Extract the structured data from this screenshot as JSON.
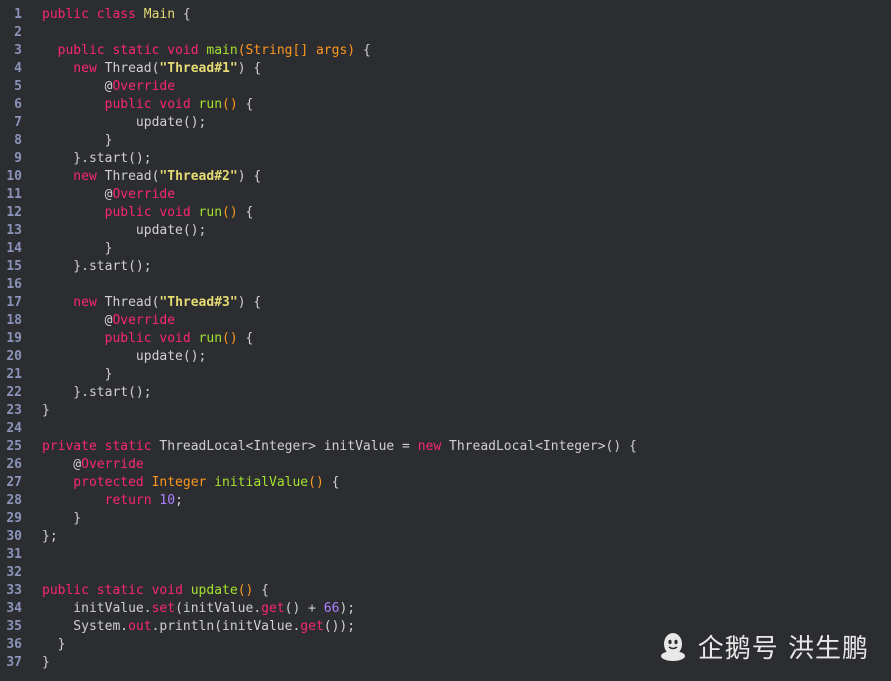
{
  "code_lines": [
    {
      "n": "1",
      "tokens": [
        {
          "t": "public ",
          "c": "kw"
        },
        {
          "t": "class ",
          "c": "kw"
        },
        {
          "t": "Main",
          "c": "ty"
        },
        {
          "t": " {",
          "c": "pl"
        }
      ]
    },
    {
      "n": "2",
      "tokens": []
    },
    {
      "n": "3",
      "tokens": [
        {
          "t": "  public ",
          "c": "kw"
        },
        {
          "t": "static ",
          "c": "kw"
        },
        {
          "t": "void ",
          "c": "kw"
        },
        {
          "t": "main",
          "c": "fn"
        },
        {
          "t": "(",
          "c": "pm"
        },
        {
          "t": "String[] ",
          "c": "pm"
        },
        {
          "t": "args",
          "c": "pm"
        },
        {
          "t": ")",
          "c": "pm"
        },
        {
          "t": " {",
          "c": "pl"
        }
      ]
    },
    {
      "n": "4",
      "tokens": [
        {
          "t": "    new ",
          "c": "kw"
        },
        {
          "t": "Thread(",
          "c": "pl"
        },
        {
          "t": "\"Thread#1\"",
          "c": "st"
        },
        {
          "t": ") {",
          "c": "pl"
        }
      ]
    },
    {
      "n": "5",
      "tokens": [
        {
          "t": "        @",
          "c": "pl"
        },
        {
          "t": "Override",
          "c": "an"
        }
      ]
    },
    {
      "n": "6",
      "tokens": [
        {
          "t": "        public ",
          "c": "kw"
        },
        {
          "t": "void ",
          "c": "kw"
        },
        {
          "t": "run",
          "c": "fn"
        },
        {
          "t": "()",
          "c": "pm"
        },
        {
          "t": " {",
          "c": "pl"
        }
      ]
    },
    {
      "n": "7",
      "tokens": [
        {
          "t": "            update();",
          "c": "pl"
        }
      ]
    },
    {
      "n": "8",
      "tokens": [
        {
          "t": "        }",
          "c": "pl"
        }
      ]
    },
    {
      "n": "9",
      "tokens": [
        {
          "t": "    }.start();",
          "c": "pl"
        }
      ]
    },
    {
      "n": "10",
      "tokens": [
        {
          "t": "    new ",
          "c": "kw"
        },
        {
          "t": "Thread(",
          "c": "pl"
        },
        {
          "t": "\"Thread#2\"",
          "c": "st"
        },
        {
          "t": ") {",
          "c": "pl"
        }
      ]
    },
    {
      "n": "11",
      "tokens": [
        {
          "t": "        @",
          "c": "pl"
        },
        {
          "t": "Override",
          "c": "an"
        }
      ]
    },
    {
      "n": "12",
      "tokens": [
        {
          "t": "        public ",
          "c": "kw"
        },
        {
          "t": "void ",
          "c": "kw"
        },
        {
          "t": "run",
          "c": "fn"
        },
        {
          "t": "()",
          "c": "pm"
        },
        {
          "t": " {",
          "c": "pl"
        }
      ]
    },
    {
      "n": "13",
      "tokens": [
        {
          "t": "            update();",
          "c": "pl"
        }
      ]
    },
    {
      "n": "14",
      "tokens": [
        {
          "t": "        }",
          "c": "pl"
        }
      ]
    },
    {
      "n": "15",
      "tokens": [
        {
          "t": "    }.start();",
          "c": "pl"
        }
      ]
    },
    {
      "n": "16",
      "tokens": []
    },
    {
      "n": "17",
      "tokens": [
        {
          "t": "    new ",
          "c": "kw"
        },
        {
          "t": "Thread(",
          "c": "pl"
        },
        {
          "t": "\"Thread#3\"",
          "c": "st"
        },
        {
          "t": ") {",
          "c": "pl"
        }
      ]
    },
    {
      "n": "18",
      "tokens": [
        {
          "t": "        @",
          "c": "pl"
        },
        {
          "t": "Override",
          "c": "an"
        }
      ]
    },
    {
      "n": "19",
      "tokens": [
        {
          "t": "        public ",
          "c": "kw"
        },
        {
          "t": "void ",
          "c": "kw"
        },
        {
          "t": "run",
          "c": "fn"
        },
        {
          "t": "()",
          "c": "pm"
        },
        {
          "t": " {",
          "c": "pl"
        }
      ]
    },
    {
      "n": "20",
      "tokens": [
        {
          "t": "            update();",
          "c": "pl"
        }
      ]
    },
    {
      "n": "21",
      "tokens": [
        {
          "t": "        }",
          "c": "pl"
        }
      ]
    },
    {
      "n": "22",
      "tokens": [
        {
          "t": "    }.start();",
          "c": "pl"
        }
      ]
    },
    {
      "n": "23",
      "tokens": [
        {
          "t": "}",
          "c": "pl"
        }
      ]
    },
    {
      "n": "24",
      "tokens": []
    },
    {
      "n": "25",
      "tokens": [
        {
          "t": "private ",
          "c": "kw"
        },
        {
          "t": "static ",
          "c": "kw"
        },
        {
          "t": "ThreadLocal<Integer> initValue = ",
          "c": "pl"
        },
        {
          "t": "new ",
          "c": "kw"
        },
        {
          "t": "ThreadLocal<Integer>() {",
          "c": "pl"
        }
      ]
    },
    {
      "n": "26",
      "tokens": [
        {
          "t": "    @",
          "c": "pl"
        },
        {
          "t": "Override",
          "c": "an"
        }
      ]
    },
    {
      "n": "27",
      "tokens": [
        {
          "t": "    protected ",
          "c": "kw"
        },
        {
          "t": "Integer ",
          "c": "pm"
        },
        {
          "t": "initialValue",
          "c": "fn"
        },
        {
          "t": "()",
          "c": "pm"
        },
        {
          "t": " {",
          "c": "pl"
        }
      ]
    },
    {
      "n": "28",
      "tokens": [
        {
          "t": "        return ",
          "c": "kw"
        },
        {
          "t": "10",
          "c": "nu"
        },
        {
          "t": ";",
          "c": "pl"
        }
      ]
    },
    {
      "n": "29",
      "tokens": [
        {
          "t": "    }",
          "c": "pl"
        }
      ]
    },
    {
      "n": "30",
      "tokens": [
        {
          "t": "};",
          "c": "pl"
        }
      ]
    },
    {
      "n": "31",
      "tokens": []
    },
    {
      "n": "32",
      "tokens": []
    },
    {
      "n": "33",
      "tokens": [
        {
          "t": "public ",
          "c": "kw"
        },
        {
          "t": "static ",
          "c": "kw"
        },
        {
          "t": "void ",
          "c": "kw"
        },
        {
          "t": "update",
          "c": "fn"
        },
        {
          "t": "()",
          "c": "pm"
        },
        {
          "t": " {",
          "c": "pl"
        }
      ]
    },
    {
      "n": "34",
      "tokens": [
        {
          "t": "    initValue.",
          "c": "pl"
        },
        {
          "t": "set",
          "c": "kw"
        },
        {
          "t": "(initValue.",
          "c": "pl"
        },
        {
          "t": "get",
          "c": "kw"
        },
        {
          "t": "() + ",
          "c": "pl"
        },
        {
          "t": "66",
          "c": "nu"
        },
        {
          "t": ");",
          "c": "pl"
        }
      ]
    },
    {
      "n": "35",
      "tokens": [
        {
          "t": "    System.",
          "c": "pl"
        },
        {
          "t": "out",
          "c": "kw"
        },
        {
          "t": ".println(initValue.",
          "c": "pl"
        },
        {
          "t": "get",
          "c": "kw"
        },
        {
          "t": "());",
          "c": "pl"
        }
      ]
    },
    {
      "n": "36",
      "tokens": [
        {
          "t": "  }",
          "c": "pl"
        }
      ]
    },
    {
      "n": "37",
      "tokens": [
        {
          "t": "}",
          "c": "pl"
        }
      ]
    }
  ],
  "watermark": {
    "text": "企鹅号 洪生鹏",
    "icon": "penguin-logo-icon"
  },
  "colors": {
    "background": "#2b2d31",
    "line_number": "#8b93b8",
    "keyword": "#f92672",
    "type": "#e6db74",
    "function": "#a6e22e",
    "param": "#fd971f",
    "string": "#e6db74",
    "number": "#ae81ff",
    "plain": "#d0d0d0"
  }
}
